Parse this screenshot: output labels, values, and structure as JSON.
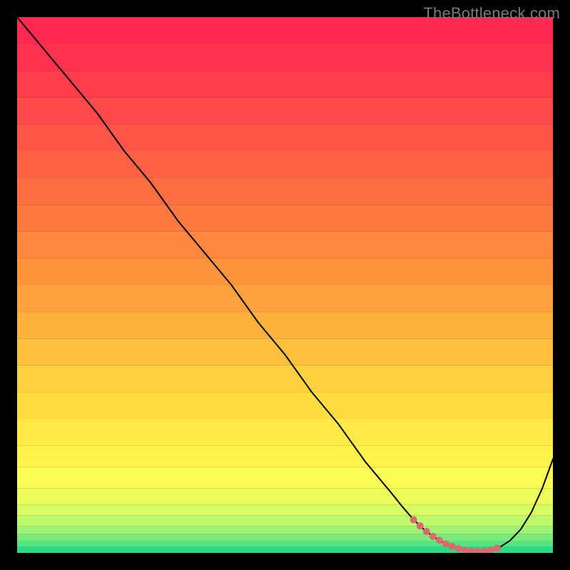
{
  "watermark": "TheBottleneck.com",
  "chart_data": {
    "type": "line",
    "title": "",
    "xlabel": "",
    "ylabel": "",
    "xlim": [
      0,
      100
    ],
    "ylim": [
      0,
      100
    ],
    "grid": false,
    "legend": false,
    "series": [
      {
        "name": "curve",
        "x": [
          0,
          5,
          10,
          15,
          20,
          25,
          30,
          35,
          40,
          45,
          50,
          55,
          60,
          65,
          70,
          72,
          74,
          76,
          78,
          80,
          82,
          84,
          86,
          88,
          90,
          92,
          94,
          96,
          98,
          100
        ],
        "y": [
          100,
          94,
          88,
          82,
          75,
          69,
          62,
          56,
          50,
          43,
          37,
          30,
          24,
          17,
          11,
          8.5,
          6.2,
          4.3,
          2.8,
          1.7,
          0.9,
          0.4,
          0.3,
          0.4,
          1.0,
          2.3,
          4.4,
          7.6,
          12.0,
          17.5
        ]
      }
    ],
    "highlight_range": {
      "x_start": 74,
      "x_end": 90,
      "color": "#d96a6e"
    },
    "background_bands": [
      {
        "y_start": 100,
        "y_end": 95,
        "color": "#ff2a52"
      },
      {
        "y_start": 95,
        "y_end": 90,
        "color": "#ff3350"
      },
      {
        "y_start": 90,
        "y_end": 85,
        "color": "#ff3e4d"
      },
      {
        "y_start": 85,
        "y_end": 80,
        "color": "#ff494a"
      },
      {
        "y_start": 80,
        "y_end": 75,
        "color": "#ff5548"
      },
      {
        "y_start": 75,
        "y_end": 70,
        "color": "#ff6145"
      },
      {
        "y_start": 70,
        "y_end": 65,
        "color": "#ff6d43"
      },
      {
        "y_start": 65,
        "y_end": 60,
        "color": "#ff7941"
      },
      {
        "y_start": 60,
        "y_end": 55,
        "color": "#ff873f"
      },
      {
        "y_start": 55,
        "y_end": 50,
        "color": "#ff943e"
      },
      {
        "y_start": 50,
        "y_end": 45,
        "color": "#ffa23d"
      },
      {
        "y_start": 45,
        "y_end": 40,
        "color": "#ffb13d"
      },
      {
        "y_start": 40,
        "y_end": 35,
        "color": "#ffc03e"
      },
      {
        "y_start": 35,
        "y_end": 30,
        "color": "#ffd040"
      },
      {
        "y_start": 30,
        "y_end": 25,
        "color": "#ffdc42"
      },
      {
        "y_start": 25,
        "y_end": 20,
        "color": "#ffe946"
      },
      {
        "y_start": 20,
        "y_end": 16,
        "color": "#fff44c"
      },
      {
        "y_start": 16,
        "y_end": 12,
        "color": "#fafd54"
      },
      {
        "y_start": 12,
        "y_end": 9,
        "color": "#edfd5c"
      },
      {
        "y_start": 9,
        "y_end": 7,
        "color": "#d8fb64"
      },
      {
        "y_start": 7,
        "y_end": 5,
        "color": "#bef86c"
      },
      {
        "y_start": 5,
        "y_end": 3.5,
        "color": "#9ff374"
      },
      {
        "y_start": 3.5,
        "y_end": 2.2,
        "color": "#7bec7b"
      },
      {
        "y_start": 2.2,
        "y_end": 1.2,
        "color": "#55e481"
      },
      {
        "y_start": 1.2,
        "y_end": 0,
        "color": "#2cd986"
      }
    ]
  }
}
